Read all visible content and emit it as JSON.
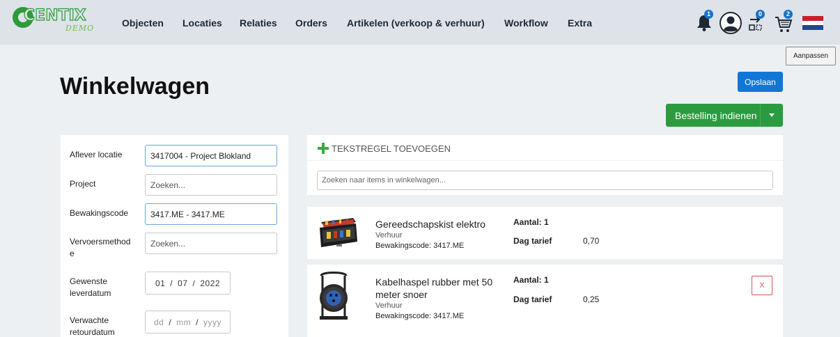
{
  "brand": {
    "logo_text": "CENTIX",
    "logo_sub": "DEMO"
  },
  "nav": [
    {
      "label": "Objecten"
    },
    {
      "label": "Locaties"
    },
    {
      "label": "Relaties"
    },
    {
      "label": "Orders"
    },
    {
      "label": "Artikelen (verkoop & verhuur)"
    },
    {
      "label": "Workflow"
    },
    {
      "label": "Extra"
    }
  ],
  "badges": {
    "notifications": "1",
    "transfer": "0",
    "cart": "2"
  },
  "header_buttons": {
    "aanpassen": "Aanpassen"
  },
  "page": {
    "title": "Winkelwagen",
    "save_label": "Opslaan",
    "submit_label": "Bestelling indienen"
  },
  "form": {
    "aflever_locatie": {
      "label": "Aflever locatie",
      "value": "3417004 - Project Blokland"
    },
    "project": {
      "label": "Project",
      "placeholder": "Zoeken..."
    },
    "bewakingscode": {
      "label": "Bewakingscode",
      "value": "3417.ME - 3417.ME"
    },
    "vervoersmethode": {
      "label": "Vervoersmethod e",
      "placeholder": "Zoeken..."
    },
    "gewenste_leverdatum": {
      "label": "Gewenste leverdatum",
      "day": "01",
      "month": "07",
      "year": "2022"
    },
    "verwachte_retourdatum": {
      "label": "Verwachte retourdatum",
      "day": "dd",
      "month": "mm",
      "year": "yyyy"
    }
  },
  "cart": {
    "add_text_line": "TEKSTREGEL TOEVOEGEN",
    "search_placeholder": "Zoeken naar items in winkelwagen...",
    "items": [
      {
        "name": "Gereedschapskist elektro",
        "type": "Verhuur",
        "code": "Bewakingscode: 3417.ME",
        "qty": "Aantal: 1",
        "rate_label": "Dag tarief",
        "rate_value": "0,70"
      },
      {
        "name": "Kabelhaspel rubber met 50 meter snoer",
        "type": "Verhuur",
        "code": "Bewakingscode: 3417.ME",
        "qty": "Aantal: 1",
        "rate_label": "Dag tarief",
        "rate_value": "0,25",
        "remove_label": "X"
      }
    ]
  },
  "colors": {
    "primary": "#1276d6",
    "success": "#2a9b3f",
    "danger": "#d9534f",
    "topbar": "#dde3e9",
    "background": "#edf0f3"
  }
}
